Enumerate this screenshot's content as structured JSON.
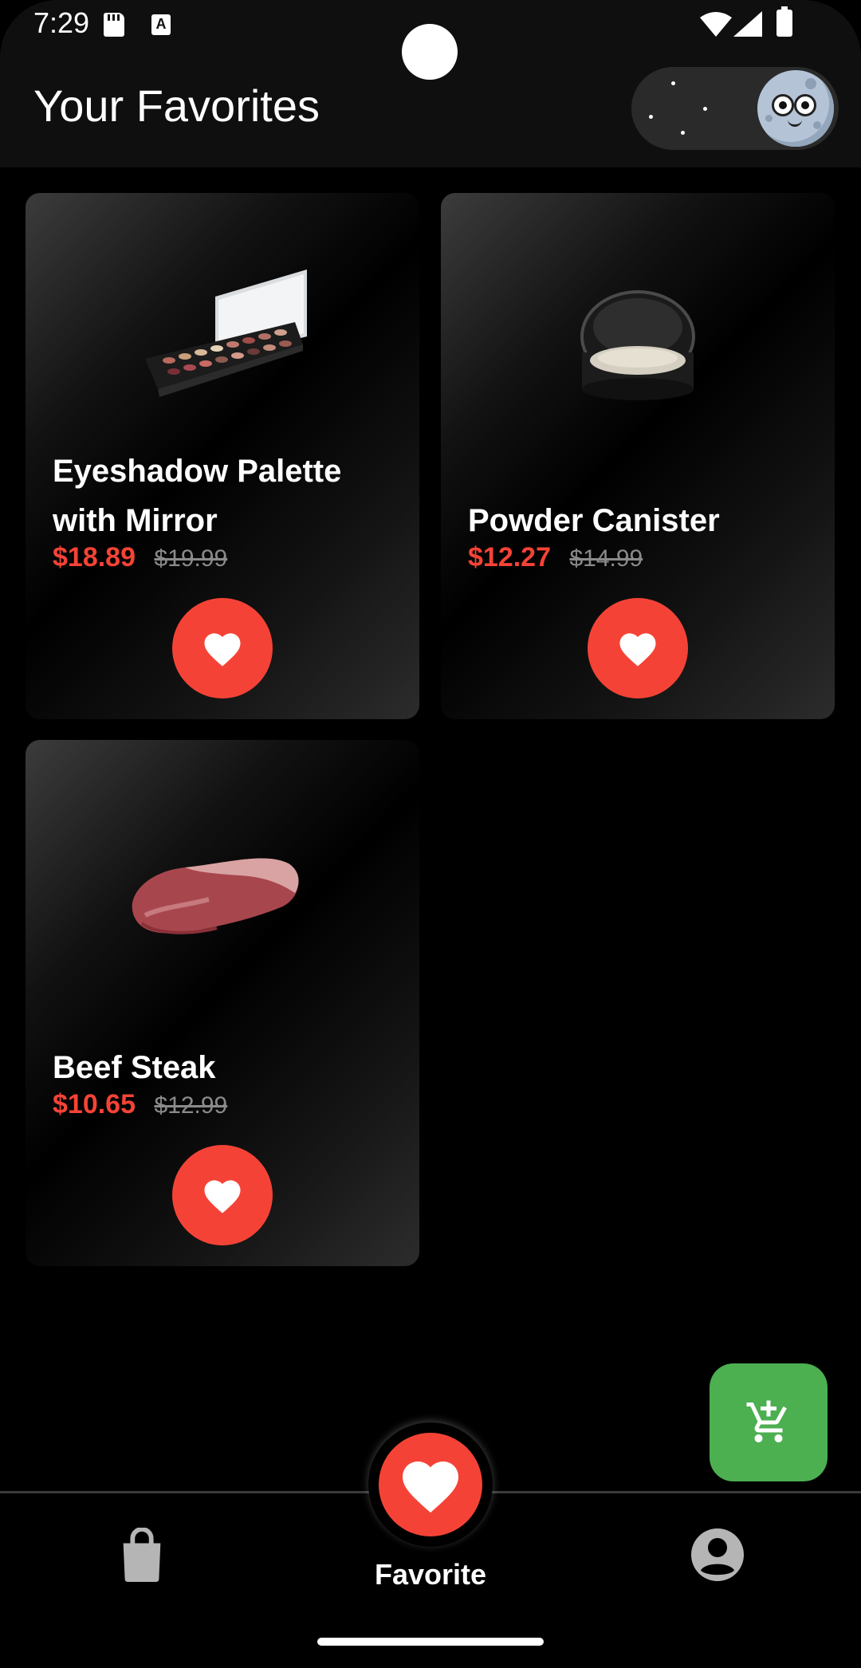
{
  "status_bar": {
    "time": "7:29",
    "icons": [
      "sd-card-icon",
      "a-notification-icon",
      "wifi-icon",
      "signal-icon",
      "battery-icon"
    ]
  },
  "header": {
    "title": "Your Favorites",
    "theme_toggle": "dark-mode-toggle"
  },
  "products": [
    {
      "name": "Eyeshadow Palette with Mirror",
      "price": "$18.89",
      "old_price": "$19.99",
      "image": "eyeshadow-palette"
    },
    {
      "name": "Powder Canister",
      "price": "$12.27",
      "old_price": "$14.99",
      "image": "powder-canister"
    },
    {
      "name": "Beef Steak",
      "price": "$10.65",
      "old_price": "$12.99",
      "image": "beef-steak"
    }
  ],
  "fab": {
    "icon": "add-to-cart-icon"
  },
  "bottom_nav": {
    "items": [
      {
        "icon": "shopping-bag-icon"
      },
      {
        "icon": "heart-icon",
        "label": "Favorite",
        "active": true
      },
      {
        "icon": "profile-icon"
      }
    ]
  },
  "colors": {
    "accent": "#f44336",
    "fab": "#4caf50",
    "background": "#000000",
    "header": "#0f0f0f"
  }
}
